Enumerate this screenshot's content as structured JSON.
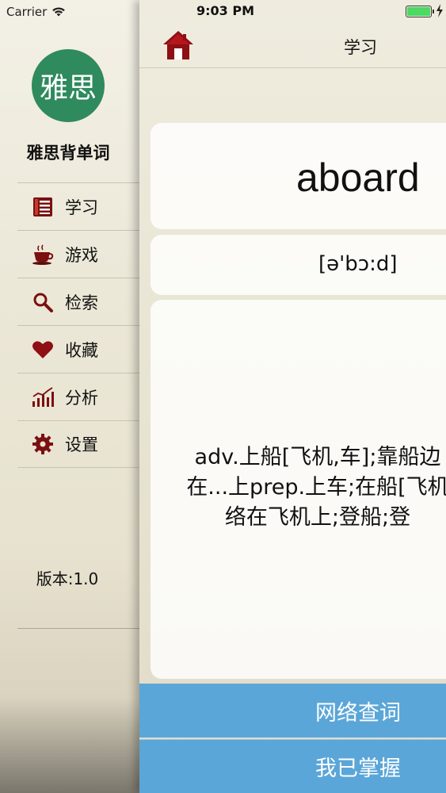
{
  "status": {
    "carrier": "Carrier",
    "time": "9:03 PM"
  },
  "drawer": {
    "avatar_text": "雅思",
    "app_name": "雅思背单词",
    "menu": [
      {
        "label": "学习",
        "icon": "list-book-icon"
      },
      {
        "label": "游戏",
        "icon": "coffee-cup-icon"
      },
      {
        "label": "检索",
        "icon": "magnifier-icon"
      },
      {
        "label": "收藏",
        "icon": "heart-icon"
      },
      {
        "label": "分析",
        "icon": "bar-chart-icon"
      },
      {
        "label": "设置",
        "icon": "gear-icon"
      }
    ],
    "version": "版本:1.0"
  },
  "navbar": {
    "title": "学习",
    "home_icon": "home-icon"
  },
  "word": {
    "text": "aboard",
    "phonetic": "[ə'bɔ:d]",
    "definition_lines": [
      "adv.上船[飞机,车];靠船边",
      "在...上prep.上车;在船[飞机",
      "络在飞机上;登船;登"
    ]
  },
  "actions": {
    "lookup": "网络查词",
    "master": "我已掌握"
  },
  "colors": {
    "avatar": "#2f8a5d",
    "action_button": "#5ba6d8",
    "battery": "#4cd964"
  }
}
